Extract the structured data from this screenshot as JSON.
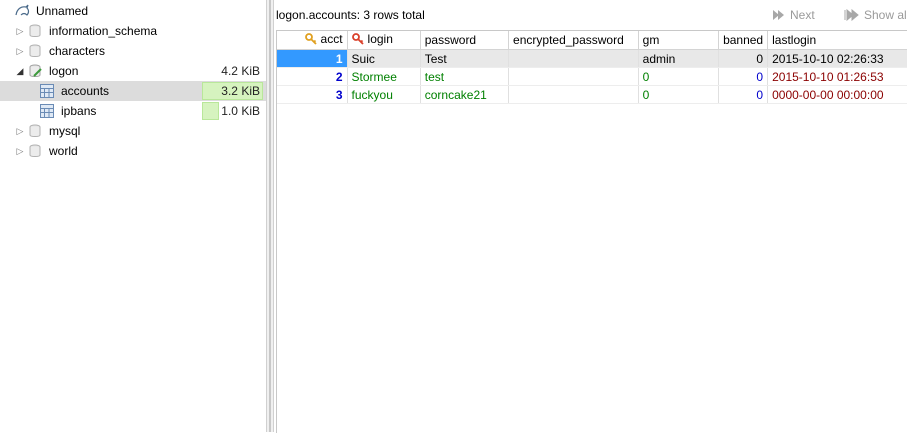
{
  "tree": {
    "root": {
      "label": "Unnamed"
    },
    "databases": [
      {
        "label": "information_schema",
        "size": "",
        "expanded": false
      },
      {
        "label": "characters",
        "size": "",
        "expanded": false
      },
      {
        "label": "logon",
        "size": "4.2 KiB",
        "expanded": true,
        "tables": [
          {
            "label": "accounts",
            "size": "3.2 KiB",
            "size_fraction": 0.76
          },
          {
            "label": "ipbans",
            "size": "1.0 KiB",
            "size_fraction": 0.24
          }
        ]
      },
      {
        "label": "mysql",
        "size": "",
        "expanded": false
      },
      {
        "label": "world",
        "size": "",
        "expanded": false
      }
    ]
  },
  "result": {
    "title": "logon.accounts: 3 rows total",
    "next_label": "Next",
    "show_all_label": "Show al"
  },
  "grid": {
    "columns": [
      "acct",
      "login",
      "password",
      "encrypted_password",
      "gm",
      "banned",
      "lastlogin"
    ],
    "rows": [
      {
        "acct": "1",
        "login": "Suic",
        "password": "Test",
        "encrypted_password": "",
        "gm": "admin",
        "banned": "0",
        "lastlogin": "2015-10-10 02:26:33"
      },
      {
        "acct": "2",
        "login": "Stormee",
        "password": "test",
        "encrypted_password": "",
        "gm": "0",
        "banned": "0",
        "lastlogin": "2015-10-10 01:26:53"
      },
      {
        "acct": "3",
        "login": "fuckyou",
        "password": "corncake21",
        "encrypted_password": "",
        "gm": "0",
        "banned": "0",
        "lastlogin": "0000-00-00 00:00:00"
      }
    ],
    "selected_row": 0
  },
  "colors": {
    "selection": "#3399ff",
    "size_bar": "#d6f3bf",
    "text_value": "#008000",
    "number_value": "#0000cc",
    "date_value": "#8b0000"
  }
}
